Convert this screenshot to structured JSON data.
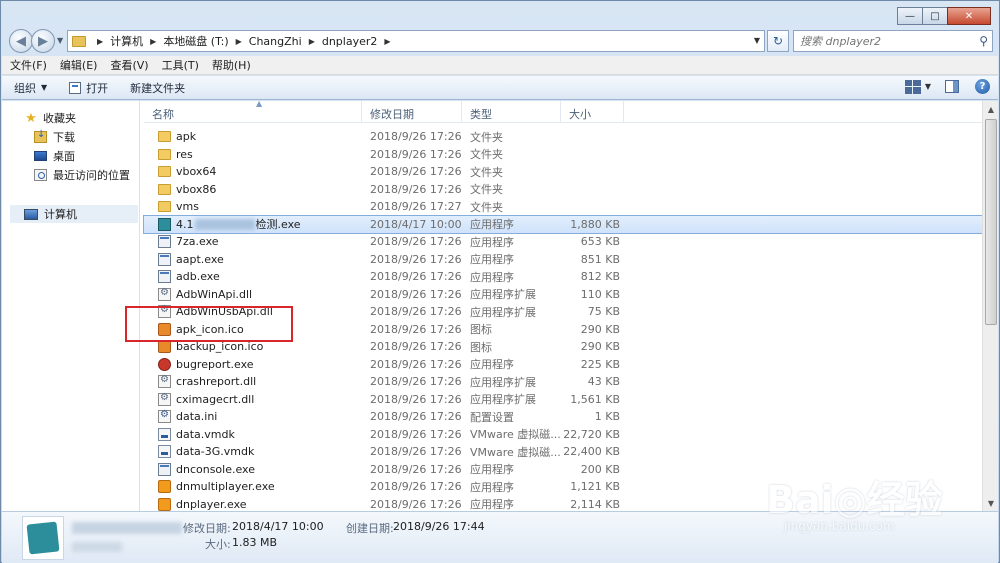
{
  "window": {
    "caption": {
      "minimize": "—",
      "maximize": "□",
      "close": "✕"
    }
  },
  "nav": {
    "back_glyph": "◀",
    "forward_glyph": "▶"
  },
  "address": {
    "crumbs": [
      "计算机",
      "本地磁盘 (T:)",
      "ChangZhi",
      "dnplayer2"
    ],
    "refresh_glyph": "↻"
  },
  "search": {
    "placeholder": "搜索 dnplayer2",
    "icon": "search-icon"
  },
  "menu": [
    "文件(F)",
    "编辑(E)",
    "查看(V)",
    "工具(T)",
    "帮助(H)"
  ],
  "toolbar": {
    "organize": "组织",
    "open": "打开",
    "new_folder": "新建文件夹",
    "help": "?"
  },
  "sidebar": {
    "favorites": "收藏夹",
    "downloads": "下载",
    "desktop": "桌面",
    "recent": "最近访问的位置",
    "computer": "计算机"
  },
  "columns": {
    "name": "名称",
    "date": "修改日期",
    "type": "类型",
    "size": "大小"
  },
  "files": [
    {
      "name": "apk",
      "date": "2018/9/26 17:26",
      "type": "文件夹",
      "size": "",
      "icon": "folder"
    },
    {
      "name": "res",
      "date": "2018/9/26 17:26",
      "type": "文件夹",
      "size": "",
      "icon": "folder"
    },
    {
      "name": "vbox64",
      "date": "2018/9/26 17:26",
      "type": "文件夹",
      "size": "",
      "icon": "folder"
    },
    {
      "name": "vbox86",
      "date": "2018/9/26 17:26",
      "type": "文件夹",
      "size": "",
      "icon": "folder"
    },
    {
      "name": "vms",
      "date": "2018/9/26 17:27",
      "type": "文件夹",
      "size": "",
      "icon": "folder"
    },
    {
      "name_prefix": "4.1",
      "name_suffix": "检测.exe",
      "date": "2018/4/17 10:00",
      "type": "应用程序",
      "size": "1,880 KB",
      "icon": "app",
      "selected": true
    },
    {
      "name": "7za.exe",
      "date": "2018/9/26 17:26",
      "type": "应用程序",
      "size": "653 KB",
      "icon": "exe"
    },
    {
      "name": "aapt.exe",
      "date": "2018/9/26 17:26",
      "type": "应用程序",
      "size": "851 KB",
      "icon": "exe"
    },
    {
      "name": "adb.exe",
      "date": "2018/9/26 17:26",
      "type": "应用程序",
      "size": "812 KB",
      "icon": "exe"
    },
    {
      "name": "AdbWinApi.dll",
      "date": "2018/9/26 17:26",
      "type": "应用程序扩展",
      "size": "110 KB",
      "icon": "dll"
    },
    {
      "name": "AdbWinUsbApi.dll",
      "date": "2018/9/26 17:26",
      "type": "应用程序扩展",
      "size": "75 KB",
      "icon": "dll"
    },
    {
      "name": "apk_icon.ico",
      "date": "2018/9/26 17:26",
      "type": "图标",
      "size": "290 KB",
      "icon": "ico"
    },
    {
      "name": "backup_icon.ico",
      "date": "2018/9/26 17:26",
      "type": "图标",
      "size": "290 KB",
      "icon": "ico"
    },
    {
      "name": "bugreport.exe",
      "date": "2018/9/26 17:26",
      "type": "应用程序",
      "size": "225 KB",
      "icon": "bug"
    },
    {
      "name": "crashreport.dll",
      "date": "2018/9/26 17:26",
      "type": "应用程序扩展",
      "size": "43 KB",
      "icon": "dll"
    },
    {
      "name": "cximagecrt.dll",
      "date": "2018/9/26 17:26",
      "type": "应用程序扩展",
      "size": "1,561 KB",
      "icon": "dll"
    },
    {
      "name": "data.ini",
      "date": "2018/9/26 17:26",
      "type": "配置设置",
      "size": "1 KB",
      "icon": "ini"
    },
    {
      "name": "data.vmdk",
      "date": "2018/9/26 17:26",
      "type": "VMware 虚拟磁...",
      "size": "22,720 KB",
      "icon": "vm"
    },
    {
      "name": "data-3G.vmdk",
      "date": "2018/9/26 17:26",
      "type": "VMware 虚拟磁...",
      "size": "22,400 KB",
      "icon": "vm"
    },
    {
      "name": "dnconsole.exe",
      "date": "2018/9/26 17:26",
      "type": "应用程序",
      "size": "200 KB",
      "icon": "exe"
    },
    {
      "name": "dnmultiplayer.exe",
      "date": "2018/9/26 17:26",
      "type": "应用程序",
      "size": "1,121 KB",
      "icon": "dn"
    },
    {
      "name": "dnplayer.exe",
      "date": "2018/9/26 17:26",
      "type": "应用程序",
      "size": "2,114 KB",
      "icon": "dn"
    }
  ],
  "details": {
    "modified_label": "修改日期:",
    "modified_value": "2018/4/17 10:00",
    "created_label": "创建日期:",
    "created_value": "2018/9/26 17:44",
    "size_label": "大小:",
    "size_value": "1.83 MB"
  },
  "watermark": {
    "main": "Bai◎经验",
    "sub": "jingyan.baidu.com"
  }
}
